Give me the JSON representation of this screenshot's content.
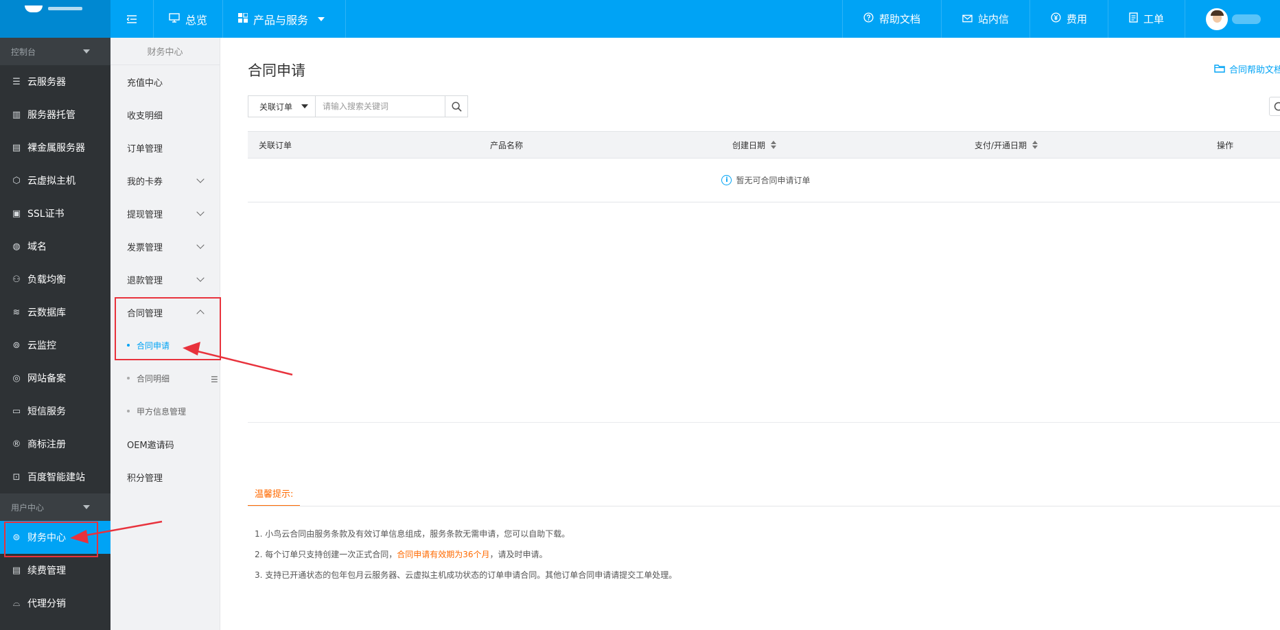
{
  "topbar": {
    "overview": "总览",
    "products": "产品与服务",
    "help_docs": "帮助文档",
    "messages": "站内信",
    "billing": "费用",
    "tickets": "工单"
  },
  "sidebar": {
    "group_console": "控制台",
    "group_user": "用户中心",
    "items": [
      {
        "label": "云服务器",
        "icon": "server-icon"
      },
      {
        "label": "服务器托管",
        "icon": "hosting-icon"
      },
      {
        "label": "裸金属服务器",
        "icon": "baremetal-icon"
      },
      {
        "label": "云虚拟主机",
        "icon": "cube-icon"
      },
      {
        "label": "SSL证书",
        "icon": "certificate-icon"
      },
      {
        "label": "域名",
        "icon": "globe-icon"
      },
      {
        "label": "负载均衡",
        "icon": "loadbalance-icon"
      },
      {
        "label": "云数据库",
        "icon": "database-icon"
      },
      {
        "label": "云监控",
        "icon": "monitor-icon"
      },
      {
        "label": "网站备案",
        "icon": "record-icon"
      },
      {
        "label": "短信服务",
        "icon": "sms-icon"
      },
      {
        "label": "商标注册",
        "icon": "trademark-icon"
      },
      {
        "label": "百度智能建站",
        "icon": "site-builder-icon"
      }
    ],
    "user_items": [
      {
        "label": "财务中心",
        "icon": "yen-icon"
      },
      {
        "label": "续费管理",
        "icon": "renew-icon"
      },
      {
        "label": "代理分销",
        "icon": "basket-icon"
      }
    ]
  },
  "subnav": {
    "title": "财务中心",
    "items": [
      {
        "label": "充值中心"
      },
      {
        "label": "收支明细"
      },
      {
        "label": "订单管理"
      },
      {
        "label": "我的卡券"
      },
      {
        "label": "提现管理"
      },
      {
        "label": "发票管理"
      },
      {
        "label": "退款管理"
      },
      {
        "label": "合同管理"
      }
    ],
    "children": [
      {
        "label": "合同申请"
      },
      {
        "label": "合同明细"
      },
      {
        "label": "甲方信息管理"
      }
    ],
    "tail_items": [
      {
        "label": "OEM邀请码"
      },
      {
        "label": "积分管理"
      }
    ]
  },
  "main": {
    "title": "合同申请",
    "help_link": "合同帮助文档",
    "search": {
      "select_value": "关联订单",
      "placeholder": "请输入搜索关键词"
    },
    "table": {
      "headers": [
        "关联订单",
        "产品名称",
        "创建日期",
        "支付/开通日期",
        "操作"
      ],
      "empty_text": "暂无可合同申请订单"
    },
    "tips": {
      "tab": "温馨提示:",
      "line1": "1. 小鸟云合同由服务条款及有效订单信息组成，服务条款无需申请，您可以自助下载。",
      "line2_a": "2. 每个订单只支持创建一次正式合同，",
      "line2_hl": "合同申请有效期为36个月",
      "line2_b": "，请及时申请。",
      "line3": "3. 支持已开通状态的包年包月云服务器、云虚拟主机成功状态的订单申请合同。其他订单合同申请请提交工单处理。"
    }
  },
  "colors": {
    "brand": "#00a3f5",
    "sidebar_bg": "#2e3235",
    "highlight": "#ff6a00",
    "annotation": "#e8323c"
  }
}
